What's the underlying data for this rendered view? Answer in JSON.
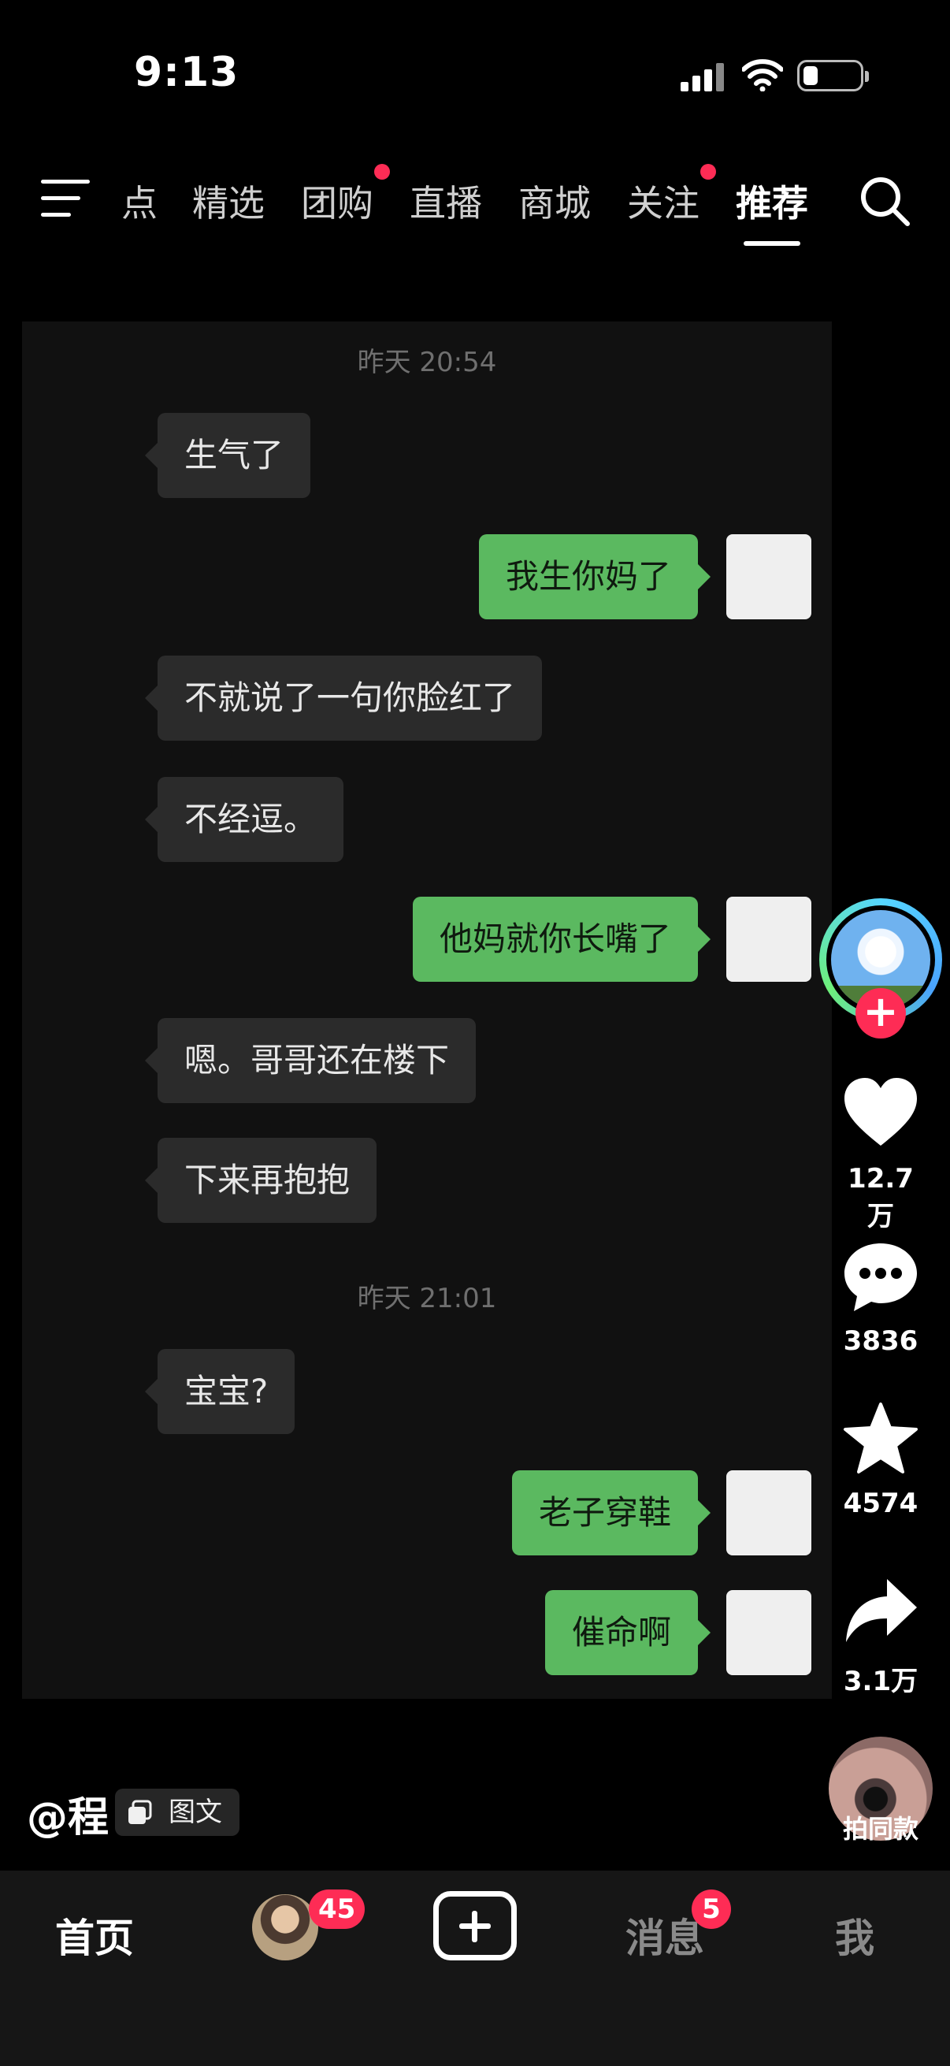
{
  "status_bar": {
    "time": "9:13"
  },
  "top_tabs": [
    {
      "label": "点",
      "has_dot": false
    },
    {
      "label": "精选",
      "has_dot": false
    },
    {
      "label": "团购",
      "has_dot": true
    },
    {
      "label": "直播",
      "has_dot": false
    },
    {
      "label": "商城",
      "has_dot": false
    },
    {
      "label": "关注",
      "has_dot": true
    },
    {
      "label": "推荐",
      "has_dot": false,
      "active": true
    }
  ],
  "chat": {
    "timestamps": [
      "昨天 20:54",
      "昨天 21:01"
    ],
    "messages": [
      {
        "side": "left",
        "text": "生气了"
      },
      {
        "side": "right",
        "text": "我生你妈了"
      },
      {
        "side": "left",
        "text": "不就说了一句你脸红了"
      },
      {
        "side": "left",
        "text": "不经逗。"
      },
      {
        "side": "right",
        "text": "他妈就你长嘴了"
      },
      {
        "side": "left",
        "text": "嗯。哥哥还在楼下"
      },
      {
        "side": "left",
        "text": "下来再抱抱"
      },
      {
        "side": "left",
        "text": "宝宝?"
      },
      {
        "side": "right",
        "text": "老子穿鞋"
      },
      {
        "side": "right",
        "text": "催命啊"
      }
    ]
  },
  "actions": {
    "likes": "12.7万",
    "comments": "3836",
    "favorites": "4574",
    "shares": "3.1万",
    "music_label": "拍同款"
  },
  "author": {
    "name": "@程",
    "post_type": "图文"
  },
  "bottom_nav": {
    "home": "首页",
    "friends_badge": "45",
    "messages": "消息",
    "messages_badge": "5",
    "me": "我"
  },
  "colors": {
    "accent_red": "#fe2c55",
    "bubble_green": "#5bb960",
    "bubble_gray": "#2b2b2b",
    "background": "#000000"
  }
}
